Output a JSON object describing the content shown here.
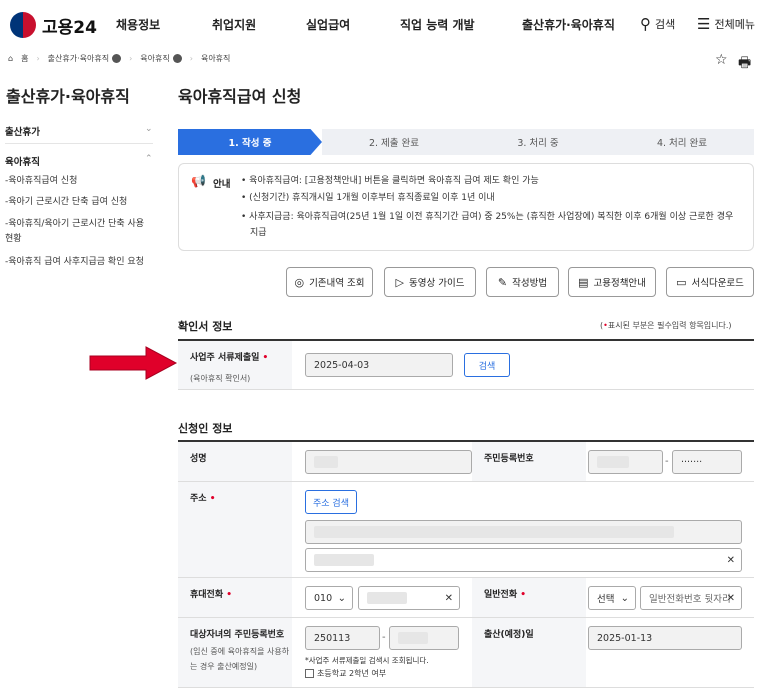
{
  "header": {
    "logo": "고용24",
    "nav": [
      "채용정보",
      "취업지원",
      "실업급여",
      "직업 능력 개발",
      "출산휴가·육아휴직"
    ],
    "search": "검색",
    "menu": "전체메뉴"
  },
  "breadcrumb": [
    "홈",
    "출산휴가·육아휴직",
    "육아휴직",
    "육아휴직"
  ],
  "sidebar": {
    "title": "출산휴가·육아휴직",
    "groups": [
      {
        "label": "출산휴가"
      },
      {
        "label": "육아휴직"
      }
    ],
    "items": [
      "-육아휴직급여 신청",
      "-육아기 근로시간 단축 급여 신청",
      "-육아휴직/육아기 근로시간 단축 사용 현황",
      "-육아휴직 급여 사후지급금 확인 요청"
    ]
  },
  "page": {
    "title": "육아휴직급여 신청"
  },
  "steps": [
    "1. 작성 중",
    "2. 제출 완료",
    "3. 처리 중",
    "4. 처리 완료"
  ],
  "notice": {
    "label": "안내",
    "lines": [
      "• 육아휴직급여: [고용정책안내] 버튼을 클릭하면 육아휴직 급여 제도 확인 가능",
      "• (신청기간) 휴직개시일 1개월 이후부터 휴직종료일 이후 1년 이내",
      "• 사후지급금: 육아휴직급여(25년 1월 1일 이전 휴직기간 급여) 중 25%는 (휴직한 사업장에) 복직한 이후 6개월 이상 근로한 경우",
      "지급"
    ]
  },
  "actions": [
    "기존내역 조회",
    "동영상 가이드",
    "작성방법",
    "고용정책안내",
    "서식다운로드"
  ],
  "confirm": {
    "title": "확인서 정보",
    "required_note": "표시된 부분은 필수입력 항목입니다.)",
    "required_open": "(",
    "label": "사업주 서류제출일",
    "sublabel": "(육아휴직 확인서)",
    "date": "2025-04-03",
    "search_btn": "검색"
  },
  "applicant": {
    "title": "신청인 정보",
    "name_label": "성명",
    "rrn_label": "주민등록번호",
    "rrn_masked": "·······",
    "address_label": "주소",
    "address_btn": "주소 검색",
    "mobile_label": "휴대전화",
    "mobile_prefix": "010",
    "phone_label": "일반전화",
    "phone_select": "선택",
    "phone_placeholder": "일반전화번호 뒷자리",
    "child_label": "대상자녀의 주민등록번호",
    "child_sub": "(임신 중에 육아휴직을 사용하는 경우 출산예정일)",
    "child_rrn": "250113",
    "child_note": "*사업주 서류제출일 검색시 조회됩니다.",
    "school_check": "초등학교 2학년 여부",
    "birth_label": "출산(예정)일",
    "birth_date": "2025-01-13"
  },
  "colors": {
    "accent": "#2a6fe0",
    "required": "#e0002a",
    "arrow": "#e0002a"
  }
}
